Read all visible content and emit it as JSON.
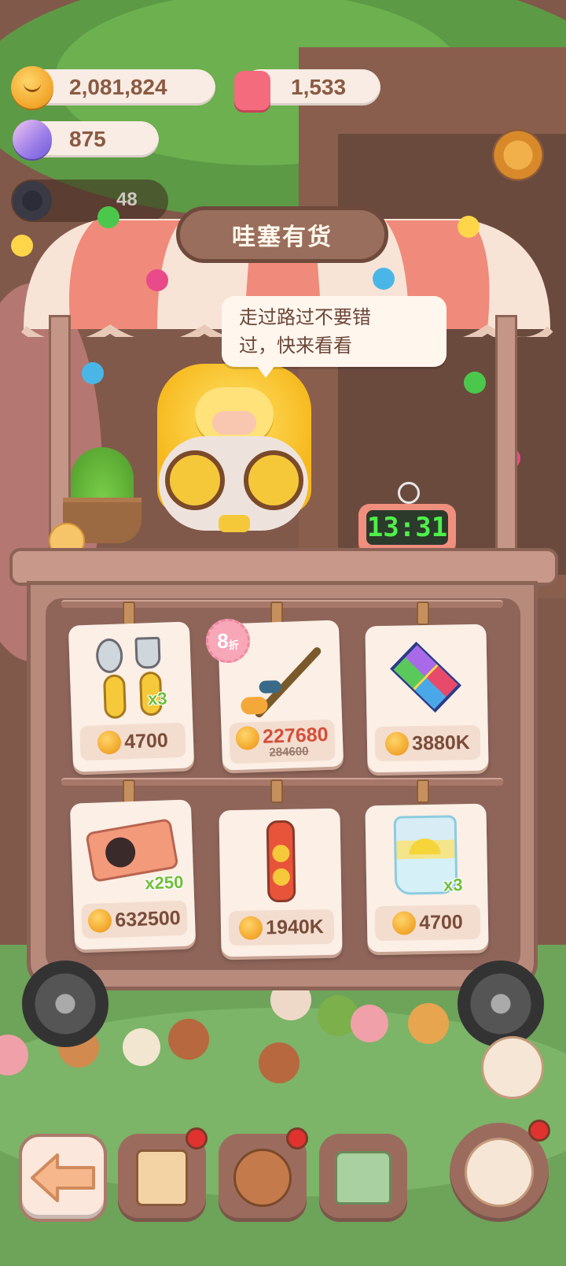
{
  "currency": {
    "coins": "2,081,824",
    "candles": "1,533",
    "gems": "875",
    "level_value": "48"
  },
  "stall": {
    "title": "哇塞有货",
    "speech": [
      "走过路过不要错",
      "过，快来看看"
    ],
    "timer": "13:31"
  },
  "items": [
    {
      "name": "spoon-fork",
      "qty": "x3",
      "price": "4700"
    },
    {
      "name": "fishing-rod",
      "discount": "8",
      "discount_suffix": "折",
      "price": "227680",
      "old_price": "284600"
    },
    {
      "name": "colorful-rug",
      "price": "3880K"
    },
    {
      "name": "ticket",
      "qty": "x250",
      "price": "632500"
    },
    {
      "name": "fancy-bone",
      "price": "1940K"
    },
    {
      "name": "lemon-water",
      "qty": "x3",
      "price": "4700"
    }
  ],
  "colors": {
    "accent_green": "#4ff04a",
    "price_discount": "#d44f3a",
    "qty_green": "#6fbf3a"
  }
}
